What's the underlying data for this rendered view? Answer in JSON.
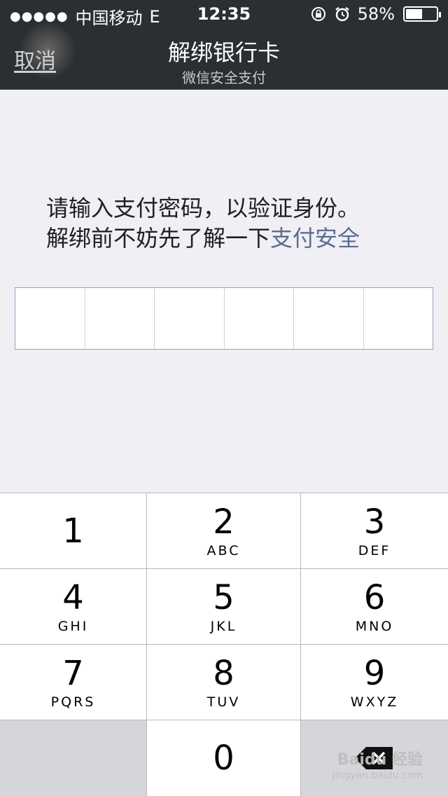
{
  "status_bar": {
    "signal": "●●●●●",
    "carrier": "中国移动",
    "network": "E",
    "time": "12:35",
    "battery": "58%",
    "battery_level": 0.58
  },
  "nav": {
    "cancel": "取消",
    "title": "解绑银行卡",
    "subtitle": "微信安全支付"
  },
  "prompt": {
    "line1": "请输入支付密码，以验证身份。",
    "line2_prefix": "解绑前不妨先了解一下",
    "line2_link": "支付安全"
  },
  "pin": {
    "length": 6
  },
  "keypad": {
    "keys": [
      {
        "num": "1",
        "letters": ""
      },
      {
        "num": "2",
        "letters": "ABC"
      },
      {
        "num": "3",
        "letters": "DEF"
      },
      {
        "num": "4",
        "letters": "GHI"
      },
      {
        "num": "5",
        "letters": "JKL"
      },
      {
        "num": "6",
        "letters": "MNO"
      },
      {
        "num": "7",
        "letters": "PQRS"
      },
      {
        "num": "8",
        "letters": "TUV"
      },
      {
        "num": "9",
        "letters": "WXYZ"
      },
      {
        "num": "0",
        "letters": ""
      }
    ],
    "delete_icon": "backspace-icon"
  },
  "watermark": {
    "brand": "Baidu 经验",
    "url": "jingyan.baidu.com"
  },
  "colors": {
    "header_bg": "#2b2f33",
    "link": "#5b6c92",
    "page_bg": "#efeff4"
  }
}
